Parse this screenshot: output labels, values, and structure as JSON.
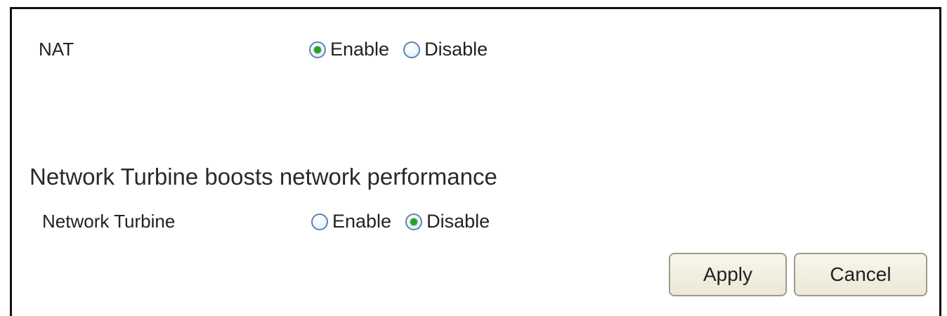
{
  "nat": {
    "label": "NAT",
    "options": [
      {
        "label": "Enable",
        "checked": true
      },
      {
        "label": "Disable",
        "checked": false
      }
    ]
  },
  "turbine": {
    "section_title": "Network Turbine boosts network performance",
    "label": "Network Turbine",
    "options": [
      {
        "label": "Enable",
        "checked": false
      },
      {
        "label": "Disable",
        "checked": true
      }
    ]
  },
  "actions": {
    "apply_label": "Apply",
    "cancel_label": "Cancel"
  },
  "colors": {
    "radio_selected": "#2aa02a",
    "radio_border": "#5a86b3",
    "button_bg": "#ebe8d6",
    "panel_border": "#111111"
  }
}
